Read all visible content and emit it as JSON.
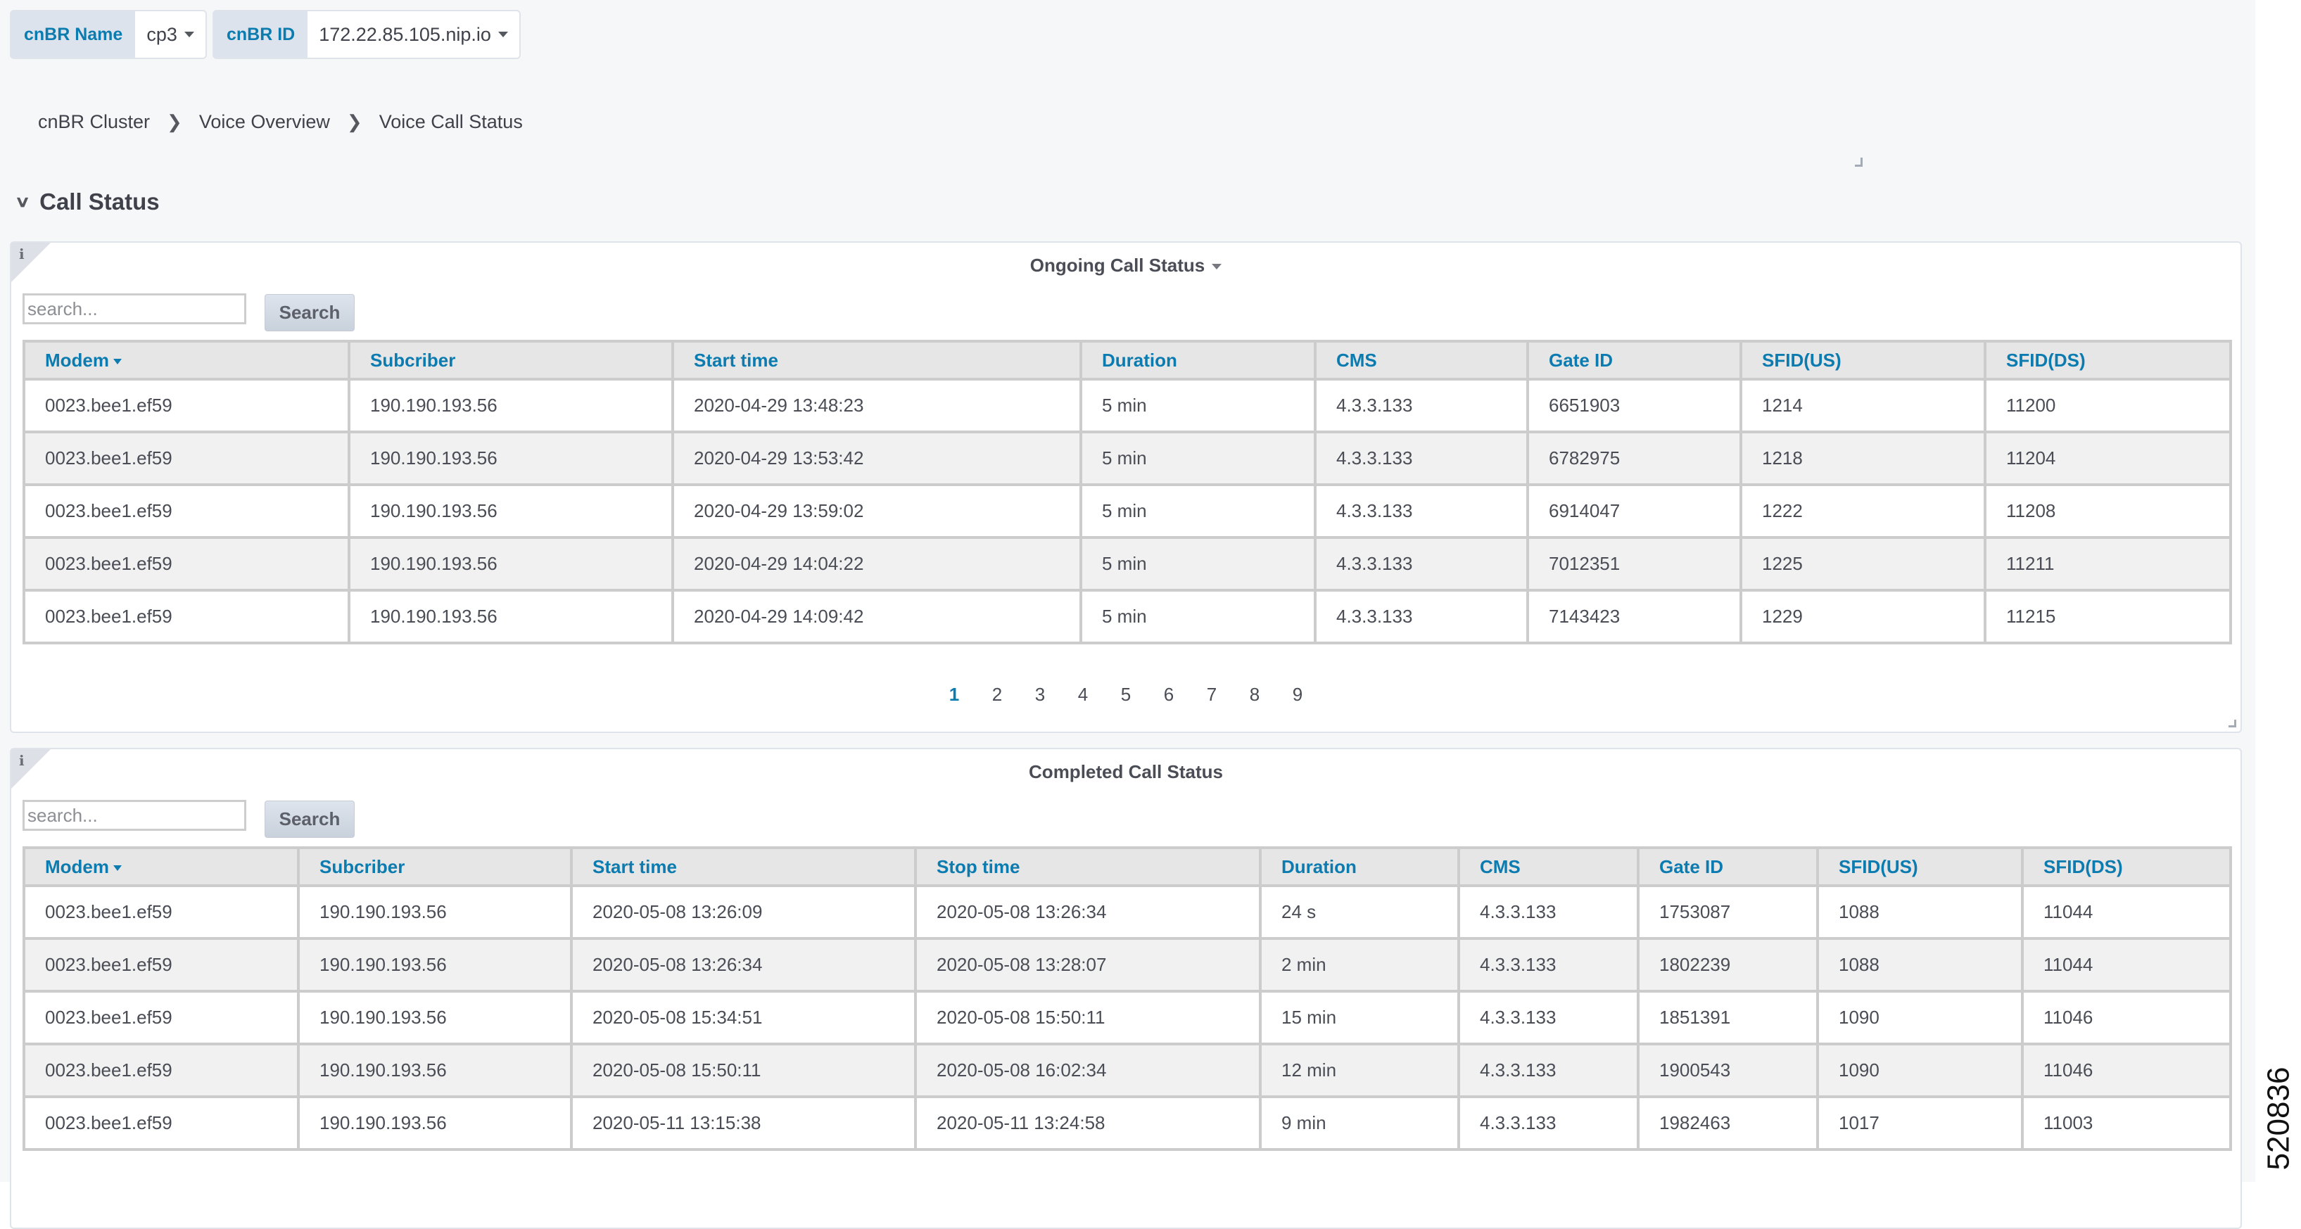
{
  "filters": {
    "cnbr_name": {
      "label": "cnBR Name",
      "value": "cp3"
    },
    "cnbr_id": {
      "label": "cnBR ID",
      "value": "172.22.85.105.nip.io"
    }
  },
  "breadcrumb": [
    "cnBR Cluster",
    "Voice Overview",
    "Voice Call Status"
  ],
  "section": {
    "title": "Call Status"
  },
  "ongoing": {
    "title": "Ongoing Call Status",
    "search_placeholder": "search...",
    "search_button": "Search",
    "columns": [
      "Modem",
      "Subcriber",
      "Start time",
      "Duration",
      "CMS",
      "Gate ID",
      "SFID(US)",
      "SFID(DS)"
    ],
    "sorted_column": "Modem",
    "rows": [
      [
        "0023.bee1.ef59",
        "190.190.193.56",
        "2020-04-29 13:48:23",
        "5 min",
        "4.3.3.133",
        "6651903",
        "1214",
        "11200"
      ],
      [
        "0023.bee1.ef59",
        "190.190.193.56",
        "2020-04-29 13:53:42",
        "5 min",
        "4.3.3.133",
        "6782975",
        "1218",
        "11204"
      ],
      [
        "0023.bee1.ef59",
        "190.190.193.56",
        "2020-04-29 13:59:02",
        "5 min",
        "4.3.3.133",
        "6914047",
        "1222",
        "11208"
      ],
      [
        "0023.bee1.ef59",
        "190.190.193.56",
        "2020-04-29 14:04:22",
        "5 min",
        "4.3.3.133",
        "7012351",
        "1225",
        "11211"
      ],
      [
        "0023.bee1.ef59",
        "190.190.193.56",
        "2020-04-29 14:09:42",
        "5 min",
        "4.3.3.133",
        "7143423",
        "1229",
        "11215"
      ]
    ],
    "pages": [
      "1",
      "2",
      "3",
      "4",
      "5",
      "6",
      "7",
      "8",
      "9"
    ],
    "current_page": "1"
  },
  "completed": {
    "title": "Completed Call Status",
    "search_placeholder": "search...",
    "search_button": "Search",
    "columns": [
      "Modem",
      "Subcriber",
      "Start time",
      "Stop time",
      "Duration",
      "CMS",
      "Gate ID",
      "SFID(US)",
      "SFID(DS)"
    ],
    "sorted_column": "Modem",
    "rows": [
      [
        "0023.bee1.ef59",
        "190.190.193.56",
        "2020-05-08 13:26:09",
        "2020-05-08 13:26:34",
        "24 s",
        "4.3.3.133",
        "1753087",
        "1088",
        "11044"
      ],
      [
        "0023.bee1.ef59",
        "190.190.193.56",
        "2020-05-08 13:26:34",
        "2020-05-08 13:28:07",
        "2 min",
        "4.3.3.133",
        "1802239",
        "1088",
        "11044"
      ],
      [
        "0023.bee1.ef59",
        "190.190.193.56",
        "2020-05-08 15:34:51",
        "2020-05-08 15:50:11",
        "15 min",
        "4.3.3.133",
        "1851391",
        "1090",
        "11046"
      ],
      [
        "0023.bee1.ef59",
        "190.190.193.56",
        "2020-05-08 15:50:11",
        "2020-05-08 16:02:34",
        "12 min",
        "4.3.3.133",
        "1900543",
        "1090",
        "11046"
      ],
      [
        "0023.bee1.ef59",
        "190.190.193.56",
        "2020-05-11 13:15:38",
        "2020-05-11 13:24:58",
        "9 min",
        "4.3.3.133",
        "1982463",
        "1017",
        "11003"
      ]
    ]
  },
  "figure_id": "520836",
  "colors": {
    "accent": "#0b7bb0",
    "background": "#f6f7f9",
    "header_bg": "#e6e6e6",
    "alt_row": "#f1f1f1"
  }
}
